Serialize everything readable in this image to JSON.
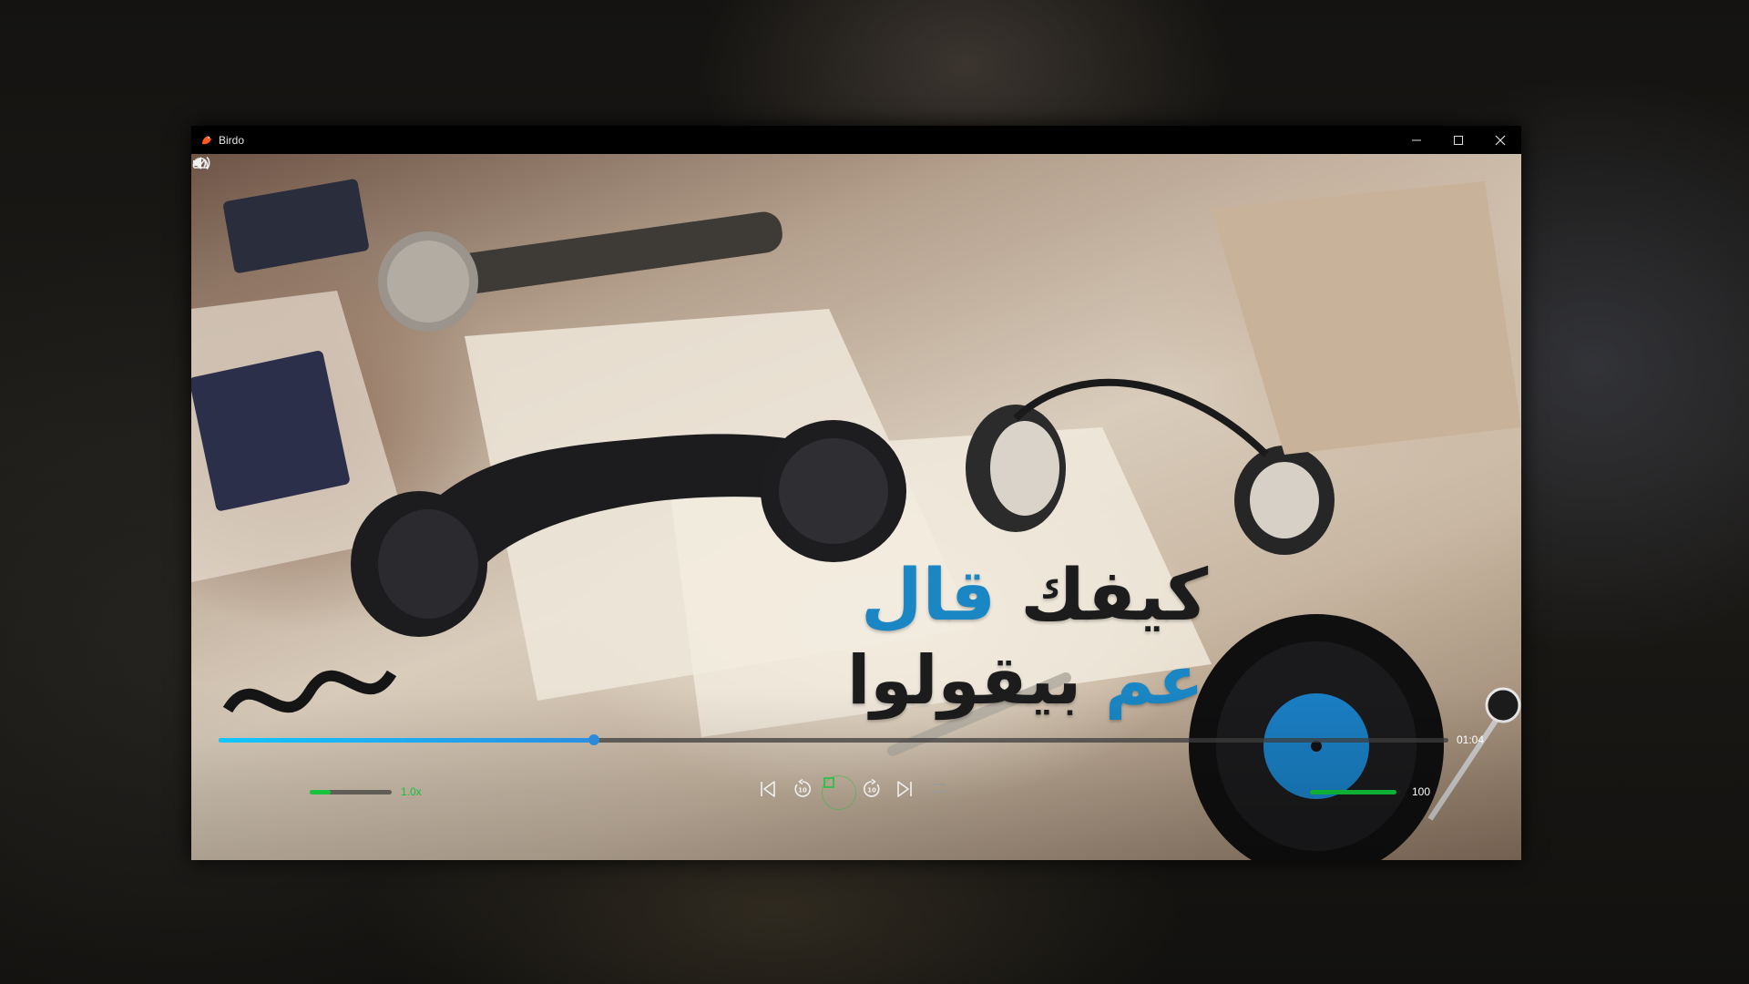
{
  "window": {
    "title": "Birdo",
    "controls": [
      "minimize-icon",
      "maximize-icon",
      "close-icon"
    ]
  },
  "video": {
    "caption_line1_black": "كيفك",
    "caption_line1_blue": "قال",
    "caption_line2_blue": "عم",
    "caption_line2_black": "بيقولوا"
  },
  "player": {
    "progress_fraction": 0.305,
    "elapsed": "01:04",
    "speed_label": "1.0x",
    "speed_fraction": 0.25,
    "volume_label": "100",
    "volume_fraction": 0.95,
    "buttons": [
      "previous-icon",
      "rewind-10-icon",
      "stop-icon",
      "forward-10-icon",
      "next-icon",
      "repeat-icon"
    ]
  },
  "colors": {
    "accent_green": "#16c43d",
    "progress_blue": "#12c6ff",
    "caption_blue": "#1a86c4"
  }
}
